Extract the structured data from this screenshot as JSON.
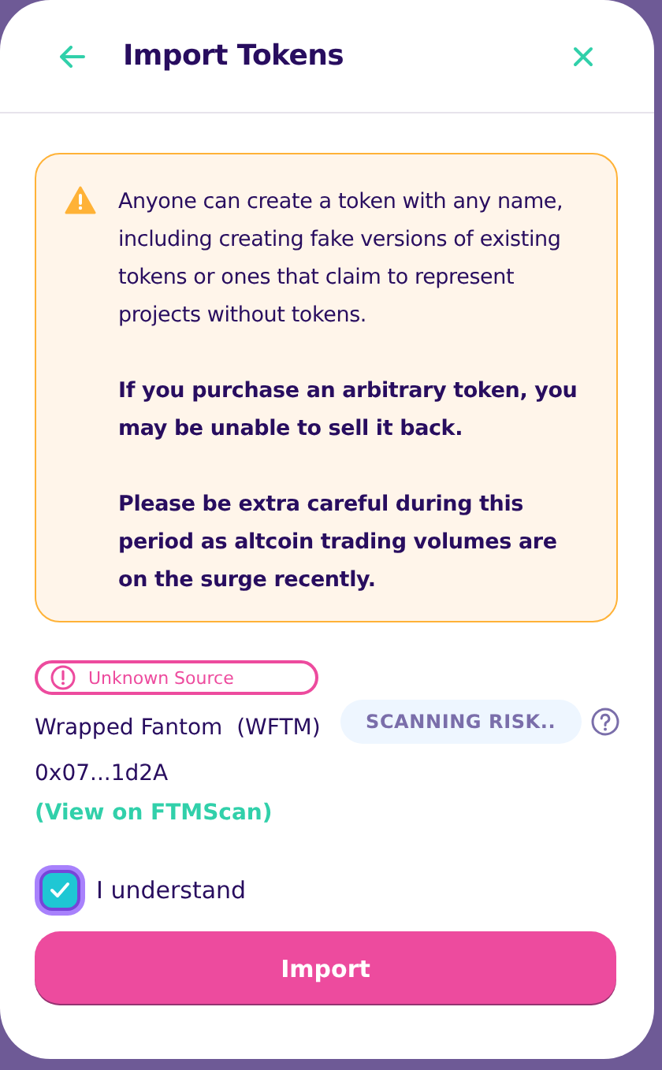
{
  "header": {
    "title": "Import Tokens"
  },
  "warning": {
    "paragraphs": [
      {
        "text": "Anyone can create a token with any name, including creating fake versions of existing tokens or ones that claim to represent projects without tokens.",
        "bold": false
      },
      {
        "text": "If you purchase an arbitrary token, you may be unable to sell it back.",
        "bold": true
      },
      {
        "text": "Please be extra careful during this period as altcoin trading volumes are on the surge recently.",
        "bold": true
      }
    ]
  },
  "token": {
    "badge": "Unknown Source",
    "name": "Wrapped Fantom  (WFTM)",
    "address": "0x07...1d2A",
    "link": "(View on FTMScan)",
    "scan_status": "SCANNING RISK.."
  },
  "acknowledge": {
    "label": "I understand",
    "checked": true
  },
  "import_button": {
    "label": "Import"
  }
}
